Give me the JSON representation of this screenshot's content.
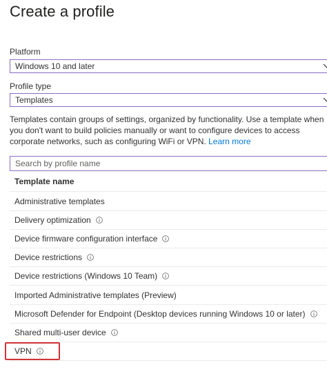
{
  "header": {
    "title": "Create a profile"
  },
  "platform": {
    "label": "Platform",
    "value": "Windows 10 and later"
  },
  "profile_type": {
    "label": "Profile type",
    "value": "Templates"
  },
  "description": {
    "text": "Templates contain groups of settings, organized by functionality. Use a template when you don't want to build policies manually or want to configure devices to access corporate networks, such as configuring WiFi or VPN.",
    "link": "Learn more"
  },
  "search": {
    "placeholder": "Search by profile name"
  },
  "table": {
    "header": "Template name",
    "rows": [
      {
        "name": "Administrative templates",
        "info": false
      },
      {
        "name": "Delivery optimization",
        "info": true
      },
      {
        "name": "Device firmware configuration interface",
        "info": true
      },
      {
        "name": "Device restrictions",
        "info": true
      },
      {
        "name": "Device restrictions (Windows 10 Team)",
        "info": true
      },
      {
        "name": "Imported Administrative templates (Preview)",
        "info": false
      },
      {
        "name": "Microsoft Defender for Endpoint (Desktop devices running Windows 10 or later)",
        "info": true
      },
      {
        "name": "Shared multi-user device",
        "info": true
      },
      {
        "name": "VPN",
        "info": true
      }
    ]
  },
  "colors": {
    "accent": "#8a6cc6",
    "link": "#0078d4",
    "highlight": "#d13438"
  }
}
